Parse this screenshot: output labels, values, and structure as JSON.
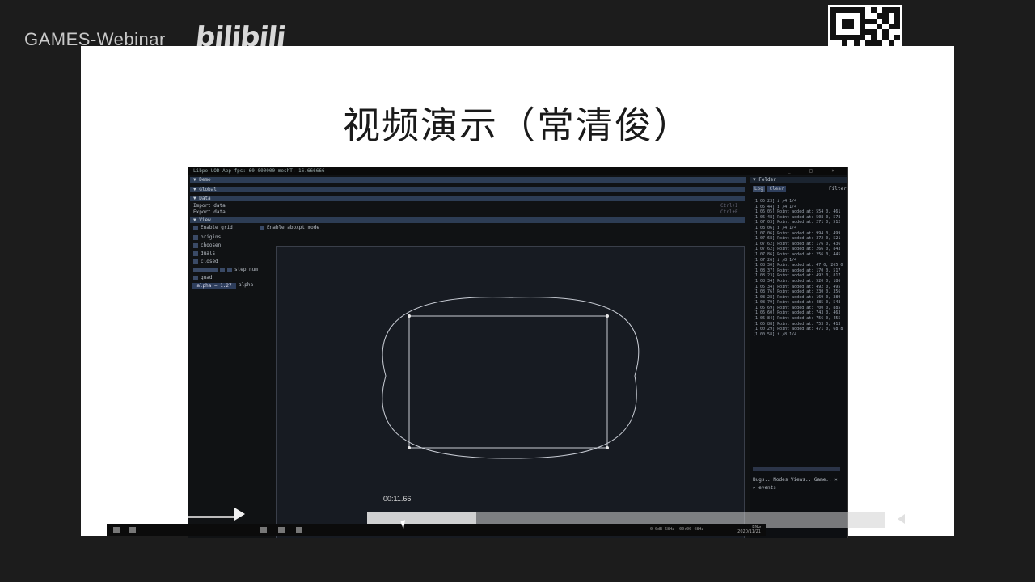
{
  "brand": {
    "name": "GAMES-Webinar",
    "logo_text": "bilibili"
  },
  "slide": {
    "title": "视频演示（常清俊）"
  },
  "app": {
    "window_title": "Libpe UOD App   fps: 60.000000   meshT: 16.666666",
    "window_buttons": "_ □ ×",
    "tab_label": "▼ Demo",
    "section_header": "▼ Global",
    "file_header": "▼ Data",
    "import_label": "Import data",
    "export_label": "Export data",
    "import_hint": "Ctrl+I",
    "export_hint": "Ctrl+E",
    "view_header": "▼ View",
    "enable_grid": "Enable grid",
    "enable_aboxpt": "Enable aboxpt mode",
    "options": [
      "origins",
      "choosen",
      "duals",
      "closed"
    ],
    "step_num_label": "step_num",
    "quad_label": "quad",
    "alpha_slider": "alpha = 1.27",
    "alpha_label": "alpha",
    "right_header": "▼ Folder",
    "right_tabs": [
      "Log",
      "Clear"
    ],
    "right_filter": "Filter",
    "log_lines": [
      "[1 05 23] i /4 1/4",
      "[1 05 44] i /4 1/4",
      "[1 06 05] Point added at: 554 0, 461",
      "[1 06 48] Point added at: 508 0, 578",
      "[1 07 03] Point added at: 271 0, 512",
      "[1 08 06] i /4 1/4",
      "[1 07 06] Point added at: 994 0, 499",
      "[1 07 68] Point added at: 372 0, 521",
      "[1 07 62] Point added at: 176 0, 436",
      "[1 07 62] Point added at: 266 0, 843",
      "[1 07 86] Point added at: 256 0, 445",
      "[1 07 26] i /8 1/4",
      "[1 08 30] Point added at: 47 0, 265 0",
      "[1 08 37] Point added at: 170 0, 517",
      "[1 08 23] Point added at: 492 0, 817",
      "[1 08 34] Point added at: 520 0, 186",
      "[1 05 34] Point added at: 492 0, 495",
      "[1 08 76] Point added at: 230 0, 356",
      "[1 08 28] Point added at: 169 0, 389",
      "[1 08 79] Point added at: 485 0, 548",
      "[1 05 69] Point added at: 700 0, 885",
      "[1 06 60] Point added at: 743 0, 463",
      "[1 06 84] Point added at: 756 0, 455",
      "[1 05 88] Point added at: 753 0, 413",
      "[1 00 29] Point added at: 471 0, 68 8",
      "[1 00 58] i /8 1/4"
    ],
    "bottom_tabs": "Bugs.. Nodes Views.. Game.. ×",
    "bottom_item": "▸ events"
  },
  "player": {
    "time": "00:11.66",
    "tray_line1": "ENG",
    "tray_line2": "2020/11/21",
    "status_text": "0 0dB 68Hz   -00:00 48Hz"
  },
  "colors": {
    "background": "#1c1c1c",
    "slide": "#ffffff",
    "app_bg": "#101214",
    "header": "#2d3d55",
    "curve": "#c8ccd4"
  }
}
